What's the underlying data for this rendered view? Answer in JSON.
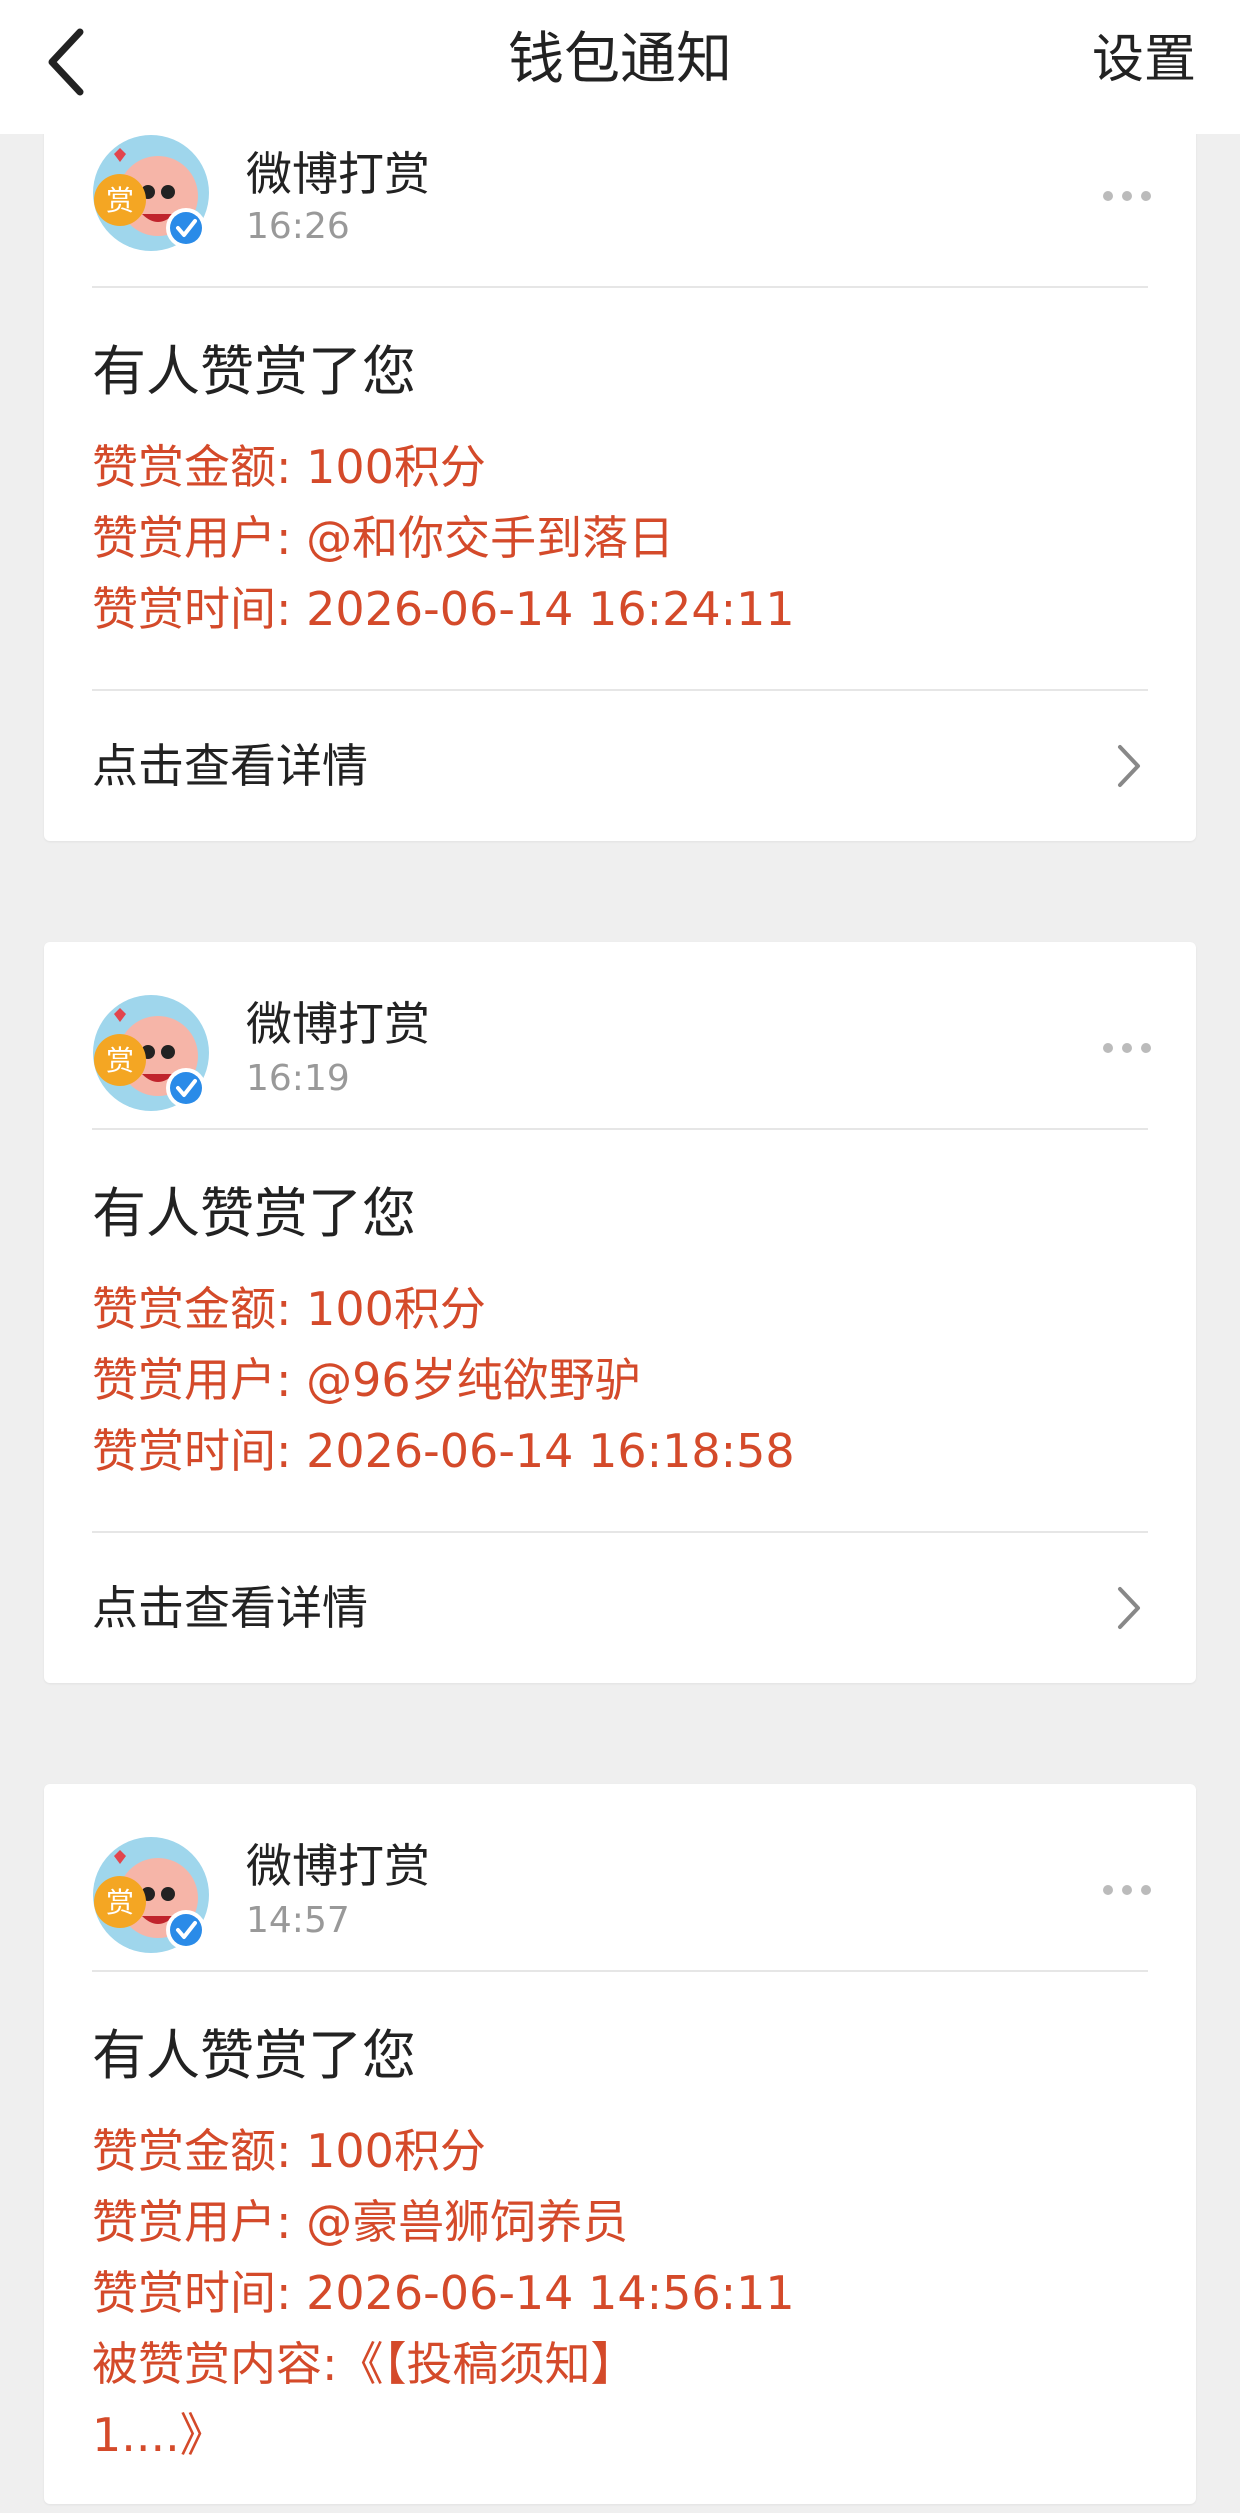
{
  "nav": {
    "title": "钱包通知",
    "settings": "设置"
  },
  "cards": [
    {
      "sender": "微博打赏",
      "time": "16:26",
      "title": "有人赞赏了您",
      "amount": "赞赏金额: 100积分",
      "user": "赞赏用户: @和你交手到落日",
      "datetime": "赞赏时间: 2026-06-14 16:24:11",
      "detail": "点击查看详情"
    },
    {
      "sender": "微博打赏",
      "time": "16:19",
      "title": "有人赞赏了您",
      "amount": "赞赏金额: 100积分",
      "user": "赞赏用户: @96岁纯欲野驴",
      "datetime": "赞赏时间: 2026-06-14 16:18:58",
      "detail": "点击查看详情"
    },
    {
      "sender": "微博打赏",
      "time": "14:57",
      "title": "有人赞赏了您",
      "amount": "赞赏金额: 100积分",
      "user": "赞赏用户: @豪兽狮饲养员",
      "datetime": "赞赏时间: 2026-06-14 14:56:11",
      "content_line1": "被赞赏内容:《【投稿须知】",
      "content_line2": "1....》"
    }
  ],
  "avatar": {
    "badge_text": "赏",
    "verified_color": "#2a8be8"
  },
  "colors": {
    "accent_text": "#d44a2a",
    "background": "#efefef"
  }
}
